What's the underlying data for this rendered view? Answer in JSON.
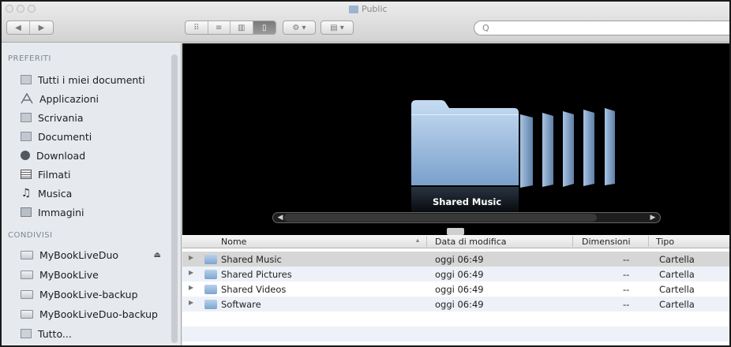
{
  "window": {
    "title": "Public"
  },
  "toolbar": {
    "nav_back": "◀",
    "nav_forward": "▶",
    "view_icons": "⠿",
    "view_list": "≡",
    "view_columns": "▥",
    "view_coverflow": "▯",
    "action": "⚙ ▾",
    "arrange": "▤ ▾",
    "search_placeholder": "Q"
  },
  "sidebar": {
    "favorites_header": "PREFERITI",
    "favorites": [
      {
        "label": "Tutti i miei documenti",
        "icon": "all-docs-icon"
      },
      {
        "label": "Applicazioni",
        "icon": "applications-icon"
      },
      {
        "label": "Scrivania",
        "icon": "desktop-icon"
      },
      {
        "label": "Documenti",
        "icon": "documents-icon"
      },
      {
        "label": "Download",
        "icon": "download-icon"
      },
      {
        "label": "Filmati",
        "icon": "movies-icon"
      },
      {
        "label": "Musica",
        "icon": "music-icon"
      },
      {
        "label": "Immagini",
        "icon": "pictures-icon"
      }
    ],
    "shared_header": "CONDIVISI",
    "shared": [
      {
        "label": "MyBookLiveDuo",
        "icon": "network-drive-icon"
      },
      {
        "label": "MyBookLive",
        "icon": "network-drive-icon"
      },
      {
        "label": "MyBookLive-backup",
        "icon": "network-drive-icon"
      },
      {
        "label": "MyBookLiveDuo-backup",
        "icon": "network-drive-icon"
      },
      {
        "label": "Tutto...",
        "icon": "network-all-icon"
      }
    ],
    "eject": "⏏"
  },
  "coverflow": {
    "caption": "Shared Music",
    "scroll_left": "◀",
    "scroll_right": "▶"
  },
  "list": {
    "columns": {
      "name": "Nome",
      "modified": "Data di modifica",
      "size": "Dimensioni",
      "type": "Tipo"
    },
    "rows": [
      {
        "name": "Shared Music",
        "modified": "oggi 06:49",
        "size": "--",
        "type": "Cartella"
      },
      {
        "name": "Shared Pictures",
        "modified": "oggi 06:49",
        "size": "--",
        "type": "Cartella"
      },
      {
        "name": "Shared Videos",
        "modified": "oggi 06:49",
        "size": "--",
        "type": "Cartella"
      },
      {
        "name": "Software",
        "modified": "oggi 06:49",
        "size": "--",
        "type": "Cartella"
      }
    ],
    "disclosure": "▶"
  },
  "colors": {
    "folder_blue": "#9fbbdc",
    "selection_gray": "#d6d6d6",
    "sidebar_bg": "#e6eaef"
  }
}
